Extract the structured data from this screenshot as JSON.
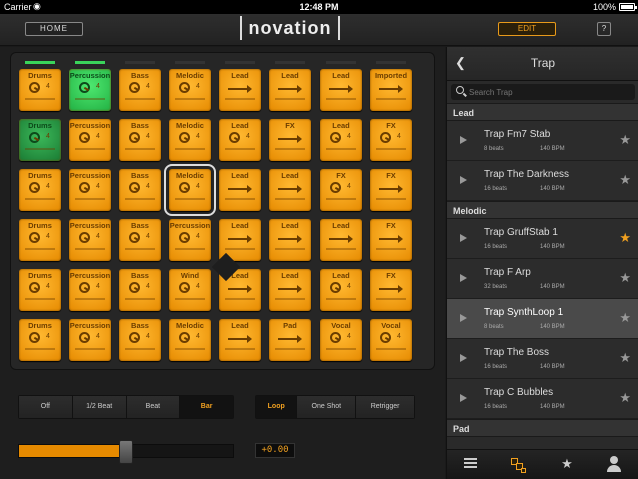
{
  "status_bar": {
    "carrier": "Carrier",
    "time": "12:48 PM",
    "battery": "100%"
  },
  "topbar": {
    "home_label": "HOME",
    "logo": "novation",
    "edit_label": "EDIT",
    "help_label": "?"
  },
  "column_indicators": [
    true,
    true,
    false,
    false,
    false,
    false,
    false,
    false
  ],
  "pads": [
    [
      {
        "label": "Drums",
        "type": "knob",
        "state": "orange"
      },
      {
        "label": "Percussion",
        "type": "knob",
        "state": "green"
      },
      {
        "label": "Bass",
        "type": "knob",
        "state": "orange"
      },
      {
        "label": "Melodic",
        "type": "knob",
        "state": "orange"
      },
      {
        "label": "Lead",
        "type": "arrow",
        "state": "orange"
      },
      {
        "label": "Lead",
        "type": "arrow",
        "state": "orange"
      },
      {
        "label": "Lead",
        "type": "arrow",
        "state": "orange"
      },
      {
        "label": "Imported",
        "type": "arrow",
        "state": "orange"
      }
    ],
    [
      {
        "label": "Drums",
        "type": "knob",
        "state": "dark-green"
      },
      {
        "label": "Percussion",
        "type": "knob",
        "state": "orange"
      },
      {
        "label": "Bass",
        "type": "knob",
        "state": "orange"
      },
      {
        "label": "Melodic",
        "type": "knob",
        "state": "orange"
      },
      {
        "label": "Lead",
        "type": "knob",
        "state": "orange"
      },
      {
        "label": "FX",
        "type": "arrow",
        "state": "orange"
      },
      {
        "label": "Lead",
        "type": "knob",
        "state": "orange"
      },
      {
        "label": "FX",
        "type": "knob",
        "state": "orange"
      }
    ],
    [
      {
        "label": "Drums",
        "type": "knob",
        "state": "orange"
      },
      {
        "label": "Percussion",
        "type": "knob",
        "state": "orange"
      },
      {
        "label": "Bass",
        "type": "knob",
        "state": "orange"
      },
      {
        "label": "Melodic",
        "type": "knob",
        "state": "orange",
        "selected": true
      },
      {
        "label": "Lead",
        "type": "arrow",
        "state": "orange"
      },
      {
        "label": "Lead",
        "type": "arrow",
        "state": "orange"
      },
      {
        "label": "FX",
        "type": "knob",
        "state": "orange"
      },
      {
        "label": "FX",
        "type": "arrow",
        "state": "orange"
      }
    ],
    [
      {
        "label": "Drums",
        "type": "knob",
        "state": "orange"
      },
      {
        "label": "Percussion",
        "type": "knob",
        "state": "orange"
      },
      {
        "label": "Bass",
        "type": "knob",
        "state": "orange"
      },
      {
        "label": "Percussion",
        "type": "knob",
        "state": "orange"
      },
      {
        "label": "Lead",
        "type": "arrow",
        "state": "orange"
      },
      {
        "label": "Lead",
        "type": "arrow",
        "state": "orange"
      },
      {
        "label": "Lead",
        "type": "arrow",
        "state": "orange"
      },
      {
        "label": "FX",
        "type": "arrow",
        "state": "orange"
      }
    ],
    [
      {
        "label": "Drums",
        "type": "knob",
        "state": "orange"
      },
      {
        "label": "Percussion",
        "type": "knob",
        "state": "orange"
      },
      {
        "label": "Bass",
        "type": "knob",
        "state": "orange"
      },
      {
        "label": "Wind",
        "type": "knob",
        "state": "orange"
      },
      {
        "label": "Lead",
        "type": "arrow",
        "state": "orange"
      },
      {
        "label": "Lead",
        "type": "arrow",
        "state": "orange"
      },
      {
        "label": "Lead",
        "type": "knob",
        "state": "orange"
      },
      {
        "label": "FX",
        "type": "arrow",
        "state": "orange"
      }
    ],
    [
      {
        "label": "Drums",
        "type": "knob",
        "state": "orange"
      },
      {
        "label": "Percussion",
        "type": "knob",
        "state": "orange"
      },
      {
        "label": "Bass",
        "type": "knob",
        "state": "orange"
      },
      {
        "label": "Melodic",
        "type": "knob",
        "state": "orange"
      },
      {
        "label": "Lead",
        "type": "arrow",
        "state": "orange"
      },
      {
        "label": "Pad",
        "type": "arrow",
        "state": "orange"
      },
      {
        "label": "Vocal",
        "type": "knob",
        "state": "orange"
      },
      {
        "label": "Vocal",
        "type": "knob",
        "state": "orange"
      }
    ]
  ],
  "pad_number": "4",
  "quantize": {
    "options": [
      "Off",
      "1/2 Beat",
      "Beat",
      "Bar"
    ],
    "selected": 3
  },
  "play_mode": {
    "options": [
      "Loop",
      "One Shot",
      "Retrigger"
    ],
    "selected": 0
  },
  "volume": {
    "level": 0.5,
    "readout": "+0.00"
  },
  "sidebar": {
    "back_icon": "chevron-left-icon",
    "title": "Trap",
    "search_placeholder": "Search Trap",
    "sections": [
      {
        "name": "Lead",
        "items": [
          {
            "name": "Trap Fm7 Stab",
            "beats": "8 beats",
            "bpm": "140 BPM",
            "favorite": false
          },
          {
            "name": "Trap The Darkness",
            "beats": "16 beats",
            "bpm": "140 BPM",
            "favorite": false
          }
        ]
      },
      {
        "name": "Melodic",
        "items": [
          {
            "name": "Trap GruffStab 1",
            "beats": "16 beats",
            "bpm": "140 BPM",
            "favorite": true
          },
          {
            "name": "Trap F Arp",
            "beats": "32 beats",
            "bpm": "140 BPM",
            "favorite": false
          },
          {
            "name": "Trap SynthLoop 1",
            "beats": "8 beats",
            "bpm": "140 BPM",
            "favorite": false,
            "active": true
          },
          {
            "name": "Trap The Boss",
            "beats": "16 beats",
            "bpm": "140 BPM",
            "favorite": false
          },
          {
            "name": "Trap C Bubbles",
            "beats": "16 beats",
            "bpm": "140 BPM",
            "favorite": false
          }
        ]
      },
      {
        "name": "Pad",
        "items": []
      }
    ],
    "tabs": [
      "list-icon",
      "loops-icon",
      "star-icon",
      "user-icon"
    ],
    "active_tab": 1
  },
  "colors": {
    "accent": "#f0a020",
    "pad_orange": "#ffa61c",
    "pad_green": "#3ad45a"
  }
}
